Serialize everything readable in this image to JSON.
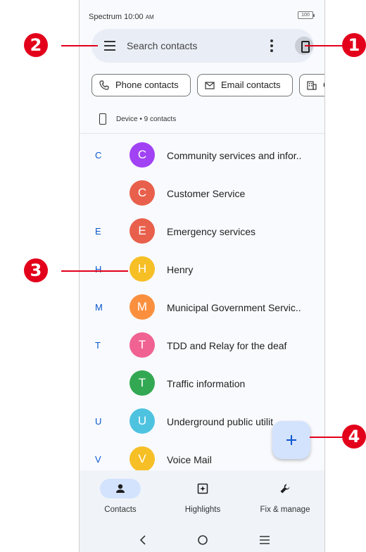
{
  "status_bar": {
    "carrier_time": "Spectrum 10:00",
    "ampm": "AM",
    "battery": "100"
  },
  "search": {
    "placeholder": "Search contacts",
    "menu_icon": "hamburger-icon",
    "more_icon": "more-vert-icon",
    "account_icon": "device-icon"
  },
  "filter_chips": [
    {
      "label": "Phone contacts",
      "icon": "phone-icon"
    },
    {
      "label": "Email contacts",
      "icon": "mail-icon"
    },
    {
      "label": "C",
      "icon": "building-icon"
    }
  ],
  "account": {
    "label": "Device • 9 contacts"
  },
  "contacts": [
    {
      "letter": "C",
      "initial": "C",
      "name": "Community services and infor..",
      "color": "#a142f4"
    },
    {
      "letter": "",
      "initial": "C",
      "name": "Customer Service",
      "color": "#e8604c"
    },
    {
      "letter": "E",
      "initial": "E",
      "name": "Emergency services",
      "color": "#e8604c"
    },
    {
      "letter": "H",
      "initial": "H",
      "name": "Henry",
      "color": "#f6bf26"
    },
    {
      "letter": "M",
      "initial": "M",
      "name": "Municipal Government Servic..",
      "color": "#fa903e"
    },
    {
      "letter": "T",
      "initial": "T",
      "name": "TDD and Relay for the deaf",
      "color": "#f06292"
    },
    {
      "letter": "",
      "initial": "T",
      "name": "Traffic information",
      "color": "#33a853"
    },
    {
      "letter": "U",
      "initial": "U",
      "name": "Underground public utilit",
      "color": "#4ec3e0"
    },
    {
      "letter": "V",
      "initial": "V",
      "name": "Voice Mail",
      "color": "#f6bf26"
    }
  ],
  "fab": {
    "icon": "plus-icon"
  },
  "bottom_nav": [
    {
      "label": "Contacts",
      "icon": "person-icon",
      "active": true
    },
    {
      "label": "Highlights",
      "icon": "highlights-icon",
      "active": false
    },
    {
      "label": "Fix & manage",
      "icon": "wrench-icon",
      "active": false
    }
  ],
  "callouts": {
    "one": "1",
    "two": "2",
    "three": "3",
    "four": "4"
  },
  "colors": {
    "callout": "#e3001b",
    "accent": "#0b57d0",
    "active_pill": "#d3e3fd"
  }
}
